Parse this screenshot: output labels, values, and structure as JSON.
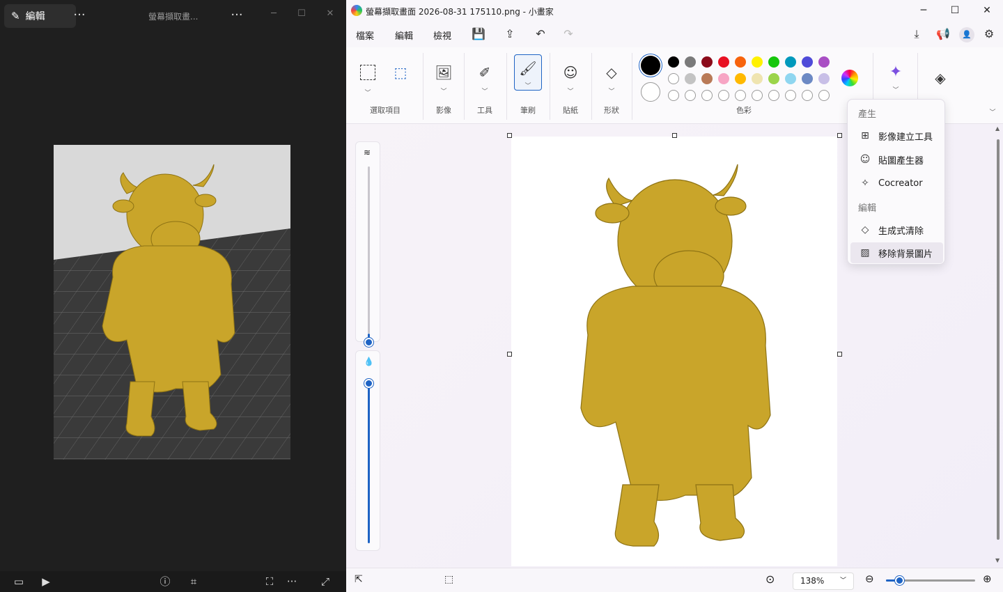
{
  "photos": {
    "edit_label": "編輯",
    "more": "···",
    "title": "螢幕擷取畫...",
    "more2": "···",
    "min": "─",
    "max": "☐",
    "close": "✕",
    "bottom_more": "···"
  },
  "paint": {
    "window_title": "螢幕擷取畫面 2026-08-31 175110.png - 小畫家",
    "min": "─",
    "max": "☐",
    "close": "✕",
    "menu": {
      "file": "檔案",
      "edit": "編輯",
      "view": "檢視"
    },
    "ribbon": {
      "selection": "選取項目",
      "image": "影像",
      "tools": "工具",
      "brushes": "筆刷",
      "stickers": "貼紙",
      "shapes": "形狀",
      "colors": "色彩"
    },
    "colors": {
      "row1": [
        "#000000",
        "#7a7a7a",
        "#8b0a1a",
        "#e81123",
        "#f7630c",
        "#fff100",
        "#16c60c",
        "#0099bc",
        "#4f4bd9",
        "#a94fc4"
      ],
      "row2": [
        "#ffffff",
        "#c3c3c3",
        "#b97a57",
        "#f7a5c4",
        "#ffb900",
        "#efe4b0",
        "#9bd44a",
        "#8fd6f0",
        "#6c89c4",
        "#c8bfe7"
      ],
      "primary": "#000000",
      "secondary": "#ffffff"
    },
    "dropdown": {
      "section_generate": "產生",
      "image_creator": "影像建立工具",
      "sticker_generator": "貼圖產生器",
      "cocreator": "Cocreator",
      "section_edit": "編輯",
      "generative_erase": "生成式清除",
      "remove_background": "移除背景圖片"
    },
    "status": {
      "zoom": "138%"
    },
    "accent": "#1e63c4"
  }
}
